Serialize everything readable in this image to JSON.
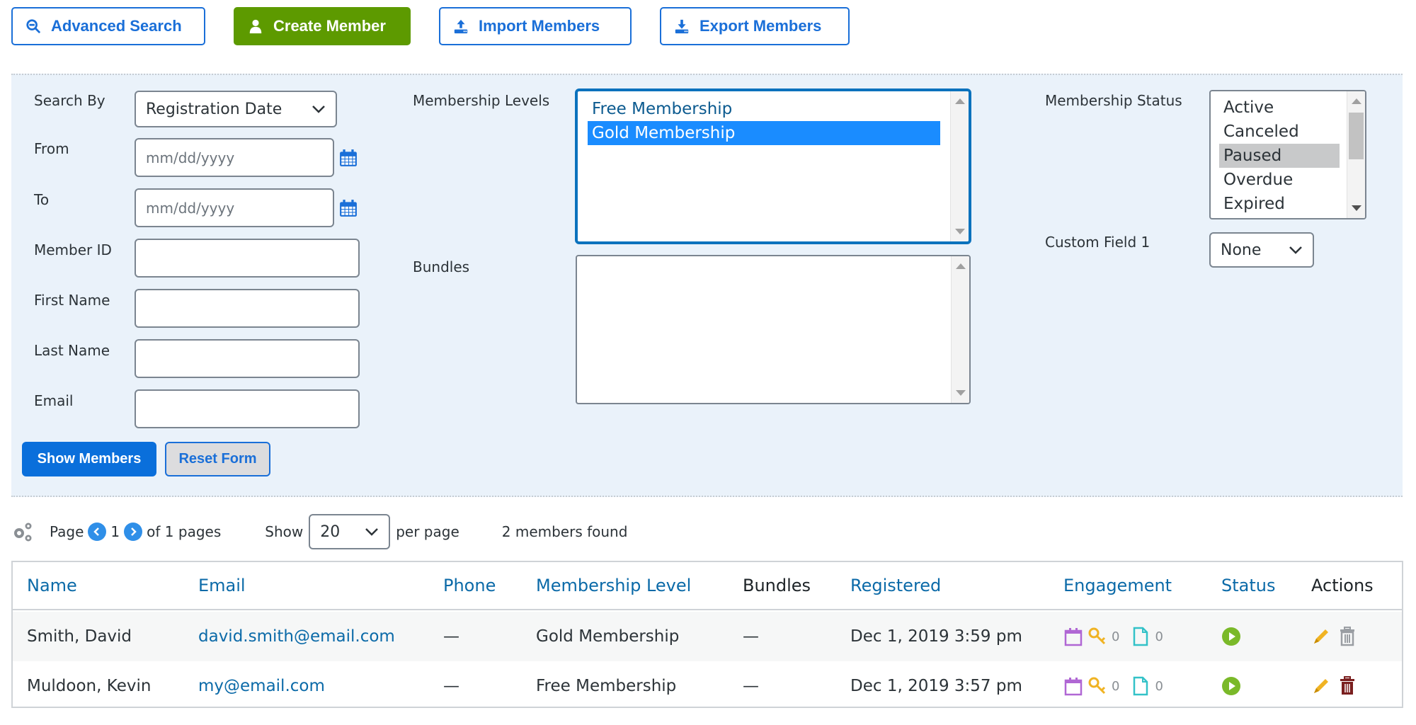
{
  "toolbar": {
    "advanced_search": "Advanced Search",
    "create_member": "Create Member",
    "import_members": "Import Members",
    "export_members": "Export Members"
  },
  "colors": {
    "primary": "#1a6fd8",
    "create": "#5d9a00",
    "panel_bg": "#eaf2fa",
    "selected_option": "#1a8cff",
    "status_active": "#7ab929",
    "edit": "#f0b323",
    "delete": "#7a1f1f"
  },
  "search": {
    "search_by_label": "Search By",
    "search_by_value": "Registration Date",
    "from_label": "From",
    "from_placeholder": "mm/dd/yyyy",
    "to_label": "To",
    "to_placeholder": "mm/dd/yyyy",
    "member_id_label": "Member ID",
    "first_name_label": "First Name",
    "last_name_label": "Last Name",
    "email_label": "Email",
    "membership_levels_label": "Membership Levels",
    "membership_levels": [
      {
        "label": "Free Membership",
        "selected": false
      },
      {
        "label": "Gold Membership",
        "selected": true
      }
    ],
    "bundles_label": "Bundles",
    "membership_status_label": "Membership Status",
    "membership_status": [
      {
        "label": "Active",
        "selected": false
      },
      {
        "label": "Canceled",
        "selected": false
      },
      {
        "label": "Paused",
        "selected": true
      },
      {
        "label": "Overdue",
        "selected": false
      },
      {
        "label": "Expired",
        "selected": false
      }
    ],
    "custom_field_label": "Custom Field 1",
    "custom_field_value": "None",
    "show_members": "Show Members",
    "reset_form": "Reset Form"
  },
  "pager": {
    "page_label": "Page",
    "current_page": "1",
    "of_pages": "of 1 pages",
    "show_label": "Show",
    "per_page_value": "20",
    "per_page_label": "per page",
    "members_found": "2 members found"
  },
  "table": {
    "headers": [
      "Name",
      "Email",
      "Phone",
      "Membership Level",
      "Bundles",
      "Registered",
      "Engagement",
      "Status",
      "Actions"
    ],
    "rows": [
      {
        "name": "Smith, David",
        "email": "david.smith@email.com",
        "phone": "—",
        "level": "Gold Membership",
        "bundles": "—",
        "registered": "Dec 1, 2019 3:59 pm",
        "logins": "0",
        "content": "0",
        "status": "active"
      },
      {
        "name": "Muldoon, Kevin",
        "email": "my@email.com",
        "phone": "—",
        "level": "Free Membership",
        "bundles": "—",
        "registered": "Dec 1, 2019 3:57 pm",
        "logins": "0",
        "content": "0",
        "status": "active"
      }
    ]
  }
}
